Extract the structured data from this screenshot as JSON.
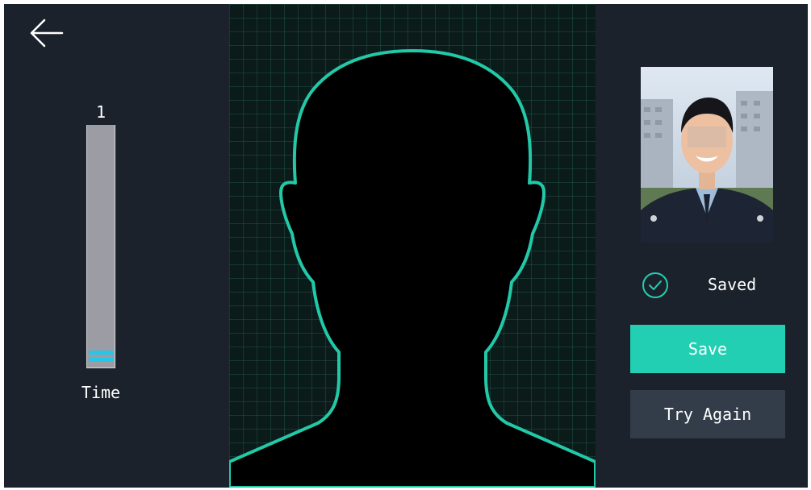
{
  "slider": {
    "value": "1",
    "label": "Time",
    "fraction": 0.0
  },
  "status": {
    "text": "Saved"
  },
  "buttons": {
    "save": "Save",
    "try_again": "Try Again"
  },
  "colors": {
    "background": "#1c222b",
    "accent": "#22cfb3",
    "secondary_button": "#333c49",
    "slider_handle": "#23c7ea",
    "face_outline": "#22c9a8"
  },
  "icons": {
    "back": "arrow-left-icon",
    "status": "check-circle-icon"
  }
}
